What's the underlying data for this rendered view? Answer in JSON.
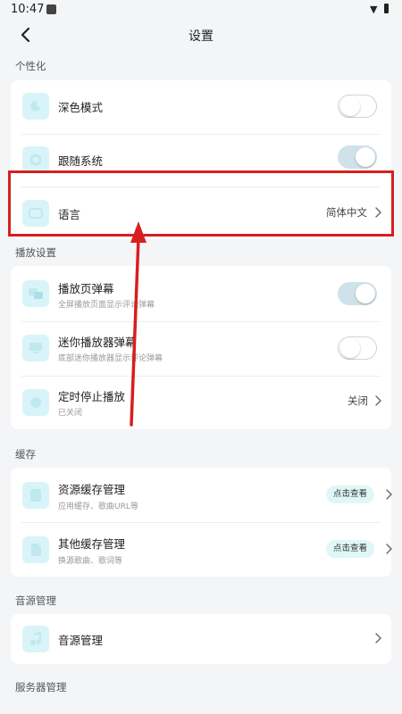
{
  "status_bar": {
    "time": "10:47"
  },
  "nav": {
    "title": "设置"
  },
  "sections": {
    "personalize": "个性化",
    "playback": "播放设置",
    "cache": "缓存",
    "source": "音源管理",
    "server": "服务器管理"
  },
  "personalize": {
    "dark_mode": {
      "label": "深色模式",
      "toggle": false
    },
    "follow_system": {
      "label": "跟随系统",
      "toggle": true
    },
    "language": {
      "label": "语言",
      "value": "简体中文"
    }
  },
  "playback": {
    "player_danmaku": {
      "label": "播放页弹幕",
      "sub": "全屏播放页面显示评论弹幕",
      "toggle": true
    },
    "mini_danmaku": {
      "label": "迷你播放器弹幕",
      "sub": "底部迷你播放器显示评论弹幕",
      "toggle": false
    },
    "sleep_timer": {
      "label": "定时停止播放",
      "sub": "已关闭",
      "value": "关闭"
    }
  },
  "cache": {
    "resource": {
      "label": "资源缓存管理",
      "sub": "应用缓存、歌曲URL等",
      "action": "点击查看"
    },
    "other": {
      "label": "其他缓存管理",
      "sub": "换源歌曲、歌词等",
      "action": "点击查看"
    }
  },
  "source": {
    "manage": {
      "label": "音源管理"
    }
  },
  "colors": {
    "accent_toggle_on": "#cfe2ea",
    "icon_bg": "#d9f4f8",
    "highlight": "#d71f1f"
  }
}
